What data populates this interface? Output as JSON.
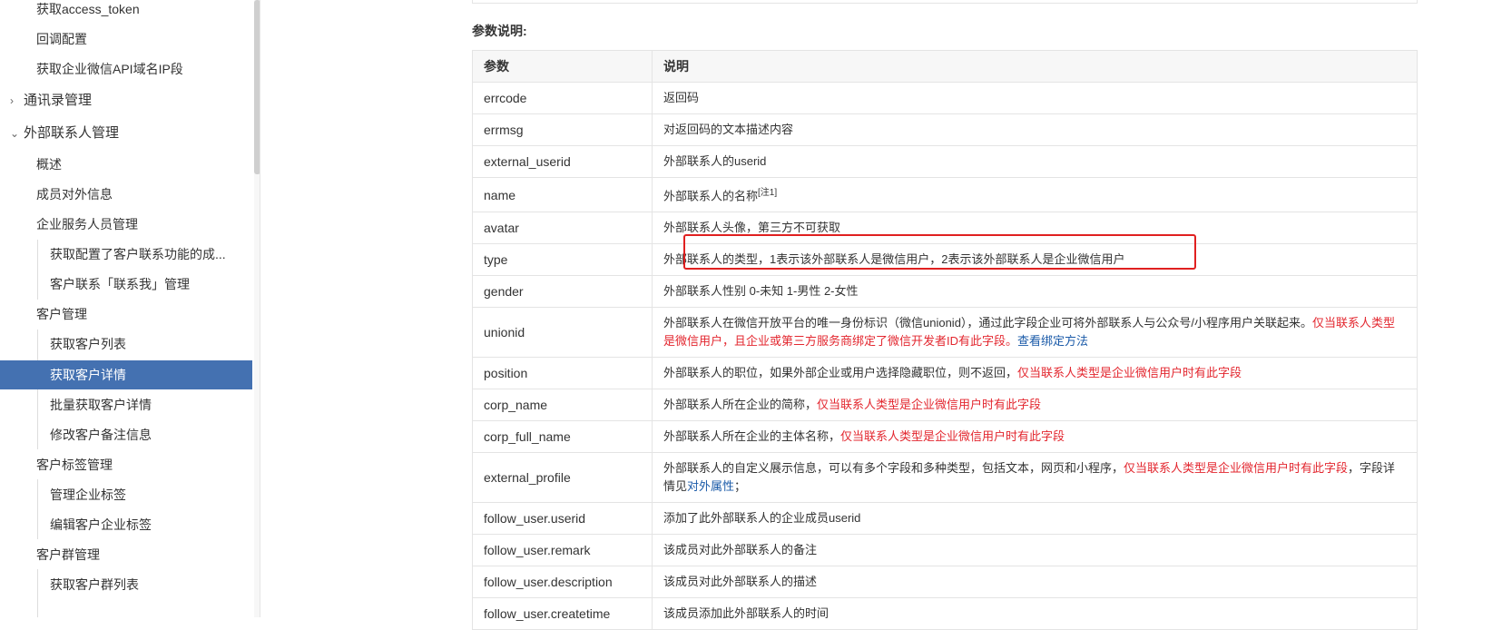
{
  "sidebar": {
    "items": [
      {
        "label": "获取access_token",
        "level": 2
      },
      {
        "label": "回调配置",
        "level": 2
      },
      {
        "label": "获取企业微信API域名IP段",
        "level": 2
      },
      {
        "label": "通讯录管理",
        "level": 1,
        "chevron": "›"
      },
      {
        "label": "外部联系人管理",
        "level": 1,
        "chevron": "⌄"
      },
      {
        "label": "概述",
        "level": 2
      },
      {
        "label": "成员对外信息",
        "level": 2
      },
      {
        "label": "企业服务人员管理",
        "level": 2
      },
      {
        "label": "获取配置了客户联系功能的成...",
        "level": 3
      },
      {
        "label": "客户联系「联系我」管理",
        "level": 3
      },
      {
        "label": "客户管理",
        "level": 2
      },
      {
        "label": "获取客户列表",
        "level": 3
      },
      {
        "label": "获取客户详情",
        "level": 3,
        "active": true
      },
      {
        "label": "批量获取客户详情",
        "level": 3
      },
      {
        "label": "修改客户备注信息",
        "level": 3
      },
      {
        "label": "客户标签管理",
        "level": 2
      },
      {
        "label": "管理企业标签",
        "level": 3
      },
      {
        "label": "编辑客户企业标签",
        "level": 3
      },
      {
        "label": "客户群管理",
        "level": 2
      },
      {
        "label": "获取客户群列表",
        "level": 3
      }
    ]
  },
  "content": {
    "params_title": "参数说明:",
    "headers": [
      "参数",
      "说明"
    ],
    "rows": [
      {
        "name": "errcode",
        "desc": "返回码"
      },
      {
        "name": "errmsg",
        "desc": "对返回码的文本描述内容"
      },
      {
        "name": "external_userid",
        "desc": "外部联系人的userid"
      },
      {
        "name": "name",
        "desc": "外部联系人的名称",
        "sup": "[注1]"
      },
      {
        "name": "avatar",
        "desc": "外部联系人头像，第三方不可获取"
      },
      {
        "name": "type",
        "desc": "外部联系人的类型，1表示该外部联系人是微信用户，2表示该外部联系人是企业微信用户"
      },
      {
        "name": "gender",
        "desc": "外部联系人性别 0-未知 1-男性 2-女性"
      },
      {
        "name": "unionid",
        "desc": "外部联系人在微信开放平台的唯一身份标识（微信unionid），通过此字段企业可将外部联系人与公众号/小程序用户关联起来。",
        "red": "仅当联系人类型是微信用户，且企业或第三方服务商绑定了微信开发者ID有此字段。",
        "link": "查看绑定方法"
      },
      {
        "name": "position",
        "desc": "外部联系人的职位，如果外部企业或用户选择隐藏职位，则不返回，",
        "red": "仅当联系人类型是企业微信用户时有此字段"
      },
      {
        "name": "corp_name",
        "desc": "外部联系人所在企业的简称，",
        "red": "仅当联系人类型是企业微信用户时有此字段"
      },
      {
        "name": "corp_full_name",
        "desc": "外部联系人所在企业的主体名称，",
        "red": "仅当联系人类型是企业微信用户时有此字段"
      },
      {
        "name": "external_profile",
        "desc": "外部联系人的自定义展示信息，可以有多个字段和多种类型，包括文本，网页和小程序，",
        "red": "仅当联系人类型是企业微信用户时有此字段",
        "tail": "，字段详情见",
        "link": "对外属性",
        "end": "；"
      },
      {
        "name": "follow_user.userid",
        "desc": "添加了此外部联系人的企业成员userid"
      },
      {
        "name": "follow_user.remark",
        "desc": "该成员对此外部联系人的备注"
      },
      {
        "name": "follow_user.description",
        "desc": "该成员对此外部联系人的描述"
      },
      {
        "name": "follow_user.createtime",
        "desc": "该成员添加此外部联系人的时间"
      }
    ]
  },
  "colors": {
    "active_bg": "#4471b1",
    "red_text": "#e3272f",
    "link": "#1a5aa8",
    "highlight_border": "#e02020"
  }
}
